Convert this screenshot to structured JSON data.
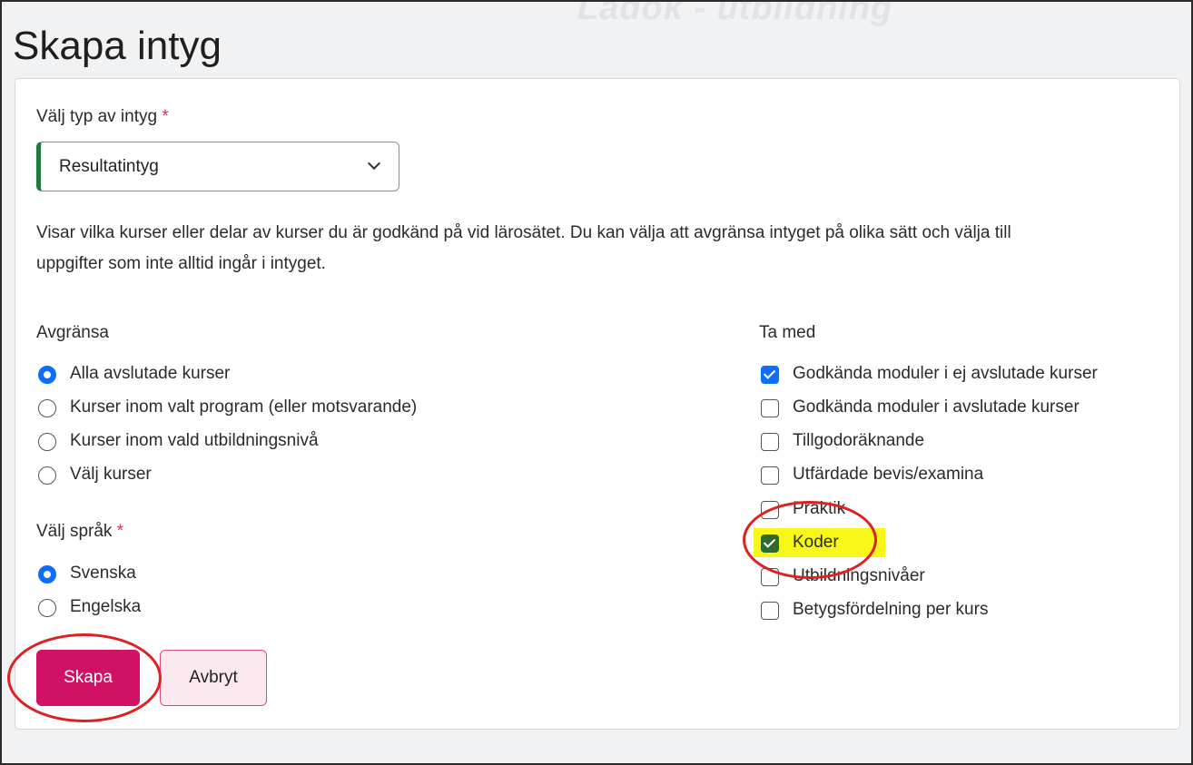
{
  "header": {
    "watermark": "Ladok - utbildning",
    "title": "Skapa intyg"
  },
  "form": {
    "type_label": "Välj typ av intyg",
    "required_mark": "*",
    "type_value": "Resultatintyg",
    "description": "Visar vilka kurser eller delar av kurser du är godkänd på vid lärosätet. Du kan välja att avgränsa intyget på olika sätt och välja till uppgifter som inte alltid ingår i intyget.",
    "limit": {
      "label": "Avgränsa",
      "options": [
        {
          "label": "Alla avslutade kurser",
          "selected": true
        },
        {
          "label": "Kurser inom valt program (eller motsvarande)",
          "selected": false
        },
        {
          "label": "Kurser inom vald utbildningsnivå",
          "selected": false
        },
        {
          "label": "Välj kurser",
          "selected": false
        }
      ]
    },
    "language": {
      "label": "Välj språk",
      "options": [
        {
          "label": "Svenska",
          "selected": true
        },
        {
          "label": "Engelska",
          "selected": false
        }
      ]
    },
    "include": {
      "label": "Ta med",
      "options": [
        {
          "label": "Godkända moduler i ej avslutade kurser",
          "checked": true
        },
        {
          "label": "Godkända moduler i avslutade kurser",
          "checked": false
        },
        {
          "label": "Tillgodoräknande",
          "checked": false
        },
        {
          "label": "Utfärdade bevis/examina",
          "checked": false
        },
        {
          "label": "Praktik",
          "checked": false
        },
        {
          "label": "Koder",
          "checked": true
        },
        {
          "label": "Utbildningsnivåer",
          "checked": false
        },
        {
          "label": "Betygsfördelning per kurs",
          "checked": false
        }
      ]
    },
    "actions": {
      "create_label": "Skapa",
      "cancel_label": "Avbryt"
    }
  },
  "colors": {
    "primary_button": "#d01166",
    "accent": "#0d6efd",
    "highlight": "#f7f71a",
    "annotation": "#e02020"
  }
}
